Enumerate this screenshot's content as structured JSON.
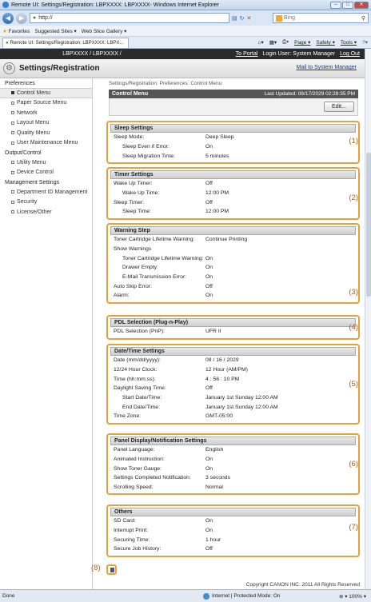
{
  "window": {
    "title": "Remote UI: Settings/Registration: LBPXXXX: LBPXXXX- Windows Internet Explorer",
    "btn_min": "–",
    "btn_max": "□",
    "btn_close": "✕"
  },
  "browser": {
    "url": "http://",
    "search_placeholder": "Bing",
    "favorites_label": "Favorites",
    "suggested_sites": "Suggested Sites ▾",
    "web_slice": "Web Slice Gallery ▾",
    "tab_title": "Remote UI: Settings/Registration: LBPXXXX: LBPX...",
    "tools": [
      "Page ▾",
      "Safety ▾",
      "Tools ▾"
    ]
  },
  "app": {
    "model": "LBPXXXX / LBPXXXX /",
    "to_portal": "To Portal",
    "login_user": "Login User: System Manager",
    "log_out": "Log Out",
    "header_title": "Settings/Registration",
    "mail_link": "Mail to System Manager"
  },
  "sidebar": {
    "sections": [
      {
        "title": "Preferences",
        "items": [
          "Control Menu",
          "Paper Source Menu",
          "Network",
          "Layout Menu",
          "Quality Menu",
          "User Maintenance Menu"
        ]
      },
      {
        "title": "Output/Control",
        "items": [
          "Utility Menu",
          "Device Control"
        ]
      },
      {
        "title": "Management Settings",
        "items": [
          "Department ID Management",
          "Security",
          "License/Other"
        ]
      }
    ]
  },
  "main": {
    "breadcrumb": "Settings/Registration: Preferences: Control Menu",
    "panel_title": "Control Menu",
    "last_updated": "Last Updated: 08/17/2029 02:28:35 PM",
    "edit_label": "Edit..."
  },
  "sections": {
    "sleep": {
      "title": "Sleep Settings",
      "num": "(1)",
      "rows": [
        [
          "Sleep Mode:",
          "Deep Sleep"
        ],
        [
          "Sleep Even if Error:",
          "On"
        ],
        [
          "Sleep Migration Time:",
          "5 minutes"
        ]
      ]
    },
    "timer": {
      "title": "Timer Settings",
      "num": "(2)",
      "rows": [
        [
          "Wake Up Timer:",
          "Off"
        ],
        [
          "Wake Up Time:",
          "12:00 PM"
        ],
        [
          "Sleep Timer:",
          "Off"
        ],
        [
          "Sleep Time:",
          "12:00 PM"
        ]
      ]
    },
    "warning": {
      "title": "Warning Step",
      "num": "(3)",
      "rows": [
        [
          "Toner Cartridge Lifetime Warning:",
          "Continue Printing"
        ],
        [
          "Show Warnings",
          ""
        ],
        [
          "Toner Cartridge Lifetime Warning:",
          "On"
        ],
        [
          "Drawer Empty:",
          "On"
        ],
        [
          "E-Mail Transmission Error:",
          "On"
        ],
        [
          "Auto Skip Error:",
          "Off"
        ],
        [
          "Alarm:",
          "On"
        ]
      ]
    },
    "pdl": {
      "title": "PDL Selection (Plug-n-Play)",
      "num": "(4)",
      "rows": [
        [
          "PDL Selection (PnP):",
          "UFR II"
        ]
      ]
    },
    "datetime": {
      "title": "Date/Time Settings",
      "num": "(5)",
      "rows": [
        [
          "Date (mm/dd/yyyy):",
          "08 / 16 / 2029"
        ],
        [
          "12/24 Hour Clock:",
          "12 Hour (AM/PM)"
        ],
        [
          "Time (hh:mm:ss):",
          "4 : 56 : 10 PM"
        ],
        [
          "Daylight Saving Time:",
          "Off"
        ],
        [
          "Start Date/Time:",
          "January 1st Sunday 12:00 AM"
        ],
        [
          "End Date/Time:",
          "January 1st Sunday 12:00 AM"
        ],
        [
          "Time Zone:",
          "GMT-05:00"
        ]
      ]
    },
    "panel": {
      "title": "Panel Display/Notification Settings",
      "num": "(6)",
      "rows": [
        [
          "Panel Language:",
          "English"
        ],
        [
          "Animated Instruction:",
          "On"
        ],
        [
          "Show Toner Gauge:",
          "On"
        ],
        [
          "Settings Completed Notification:",
          "3 seconds"
        ],
        [
          "Scrolling Speed:",
          "Normal"
        ]
      ]
    },
    "others": {
      "title": "Others",
      "num": "(7)",
      "rows": [
        [
          "SD Card:",
          "On"
        ],
        [
          "Interrupt Print:",
          "On"
        ],
        [
          "Securing Time:",
          "1 hour"
        ],
        [
          "Secure Job History:",
          "Off"
        ]
      ]
    }
  },
  "footer": {
    "num": "(8)",
    "copyright": "Copyright CANON INC. 2011 All Rights Reserved"
  },
  "status": {
    "left": "Done",
    "zone": "Internet | Protected Mode: On",
    "zoom": "100%"
  }
}
